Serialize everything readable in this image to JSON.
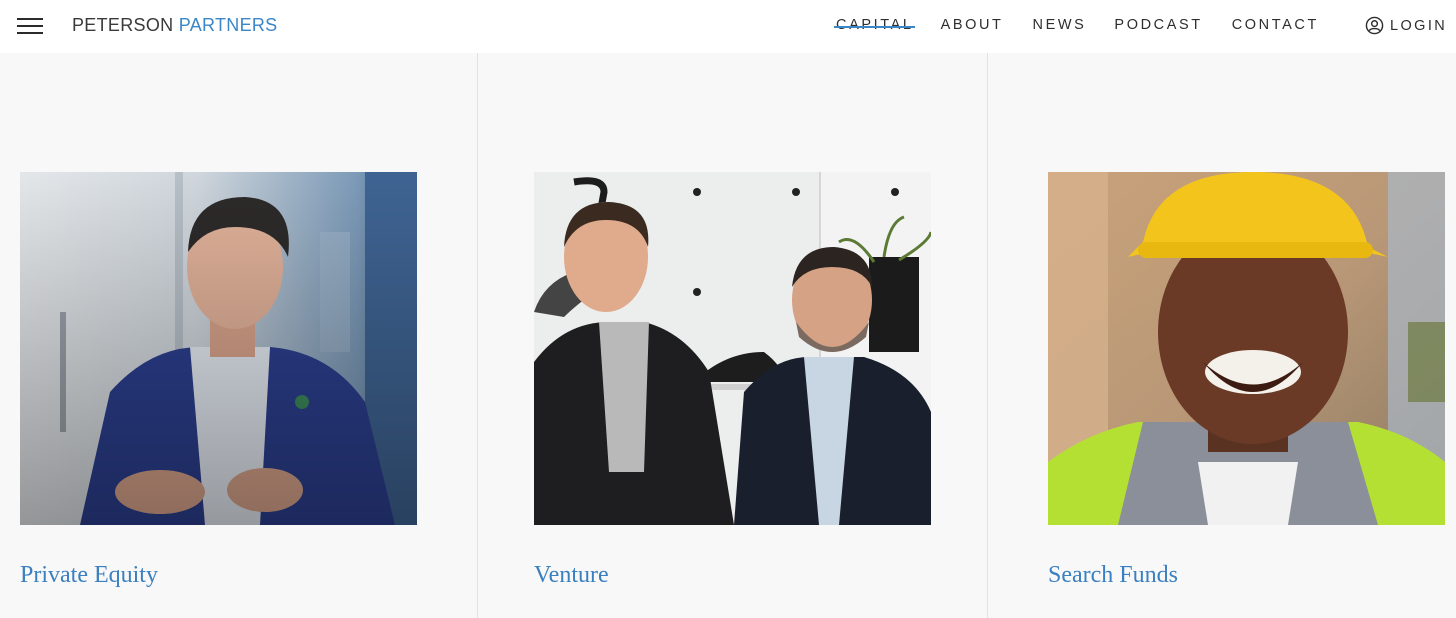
{
  "header": {
    "logo_primary": "PETERSON",
    "logo_accent": "PARTNERS",
    "menu_icon": "hamburger-icon",
    "nav": [
      {
        "label": "CAPITAL",
        "active": true
      },
      {
        "label": "ABOUT",
        "active": false
      },
      {
        "label": "NEWS",
        "active": false
      },
      {
        "label": "PODCAST",
        "active": false
      },
      {
        "label": "CONTACT",
        "active": false
      }
    ],
    "login_label": "LOGIN",
    "login_icon": "user-circle-icon"
  },
  "cards": [
    {
      "title": "Private Equity"
    },
    {
      "title": "Venture"
    },
    {
      "title": "Search Funds"
    }
  ],
  "colors": {
    "accent": "#3a86c8",
    "title": "#3a7fbf",
    "background": "#f8f8f8",
    "header_bg": "#ffffff",
    "text": "#2e2e2e"
  }
}
